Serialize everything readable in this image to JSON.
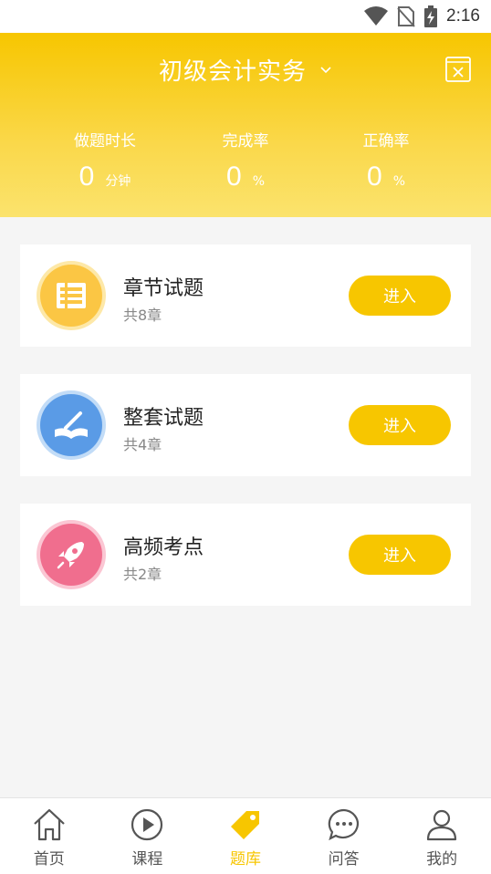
{
  "status_bar": {
    "time": "2:16"
  },
  "header": {
    "title": "初级会计实务",
    "stats": [
      {
        "label": "做题时长",
        "value": "0",
        "unit": "分钟"
      },
      {
        "label": "完成率",
        "value": "0",
        "unit": "%"
      },
      {
        "label": "正确率",
        "value": "0",
        "unit": "%"
      }
    ]
  },
  "cards": [
    {
      "title": "章节试题",
      "subtitle": "共8章",
      "button": "进入",
      "icon": "chapter-icon",
      "color": "#fbc644"
    },
    {
      "title": "整套试题",
      "subtitle": "共4章",
      "button": "进入",
      "icon": "book-pen-icon",
      "color": "#5a9be6"
    },
    {
      "title": "高频考点",
      "subtitle": "共2章",
      "button": "进入",
      "icon": "rocket-icon",
      "color": "#f06e8e"
    }
  ],
  "nav": [
    {
      "label": "首页",
      "icon": "home-icon"
    },
    {
      "label": "课程",
      "icon": "play-icon"
    },
    {
      "label": "题库",
      "icon": "tag-icon",
      "active": true
    },
    {
      "label": "问答",
      "icon": "chat-icon"
    },
    {
      "label": "我的",
      "icon": "user-icon"
    }
  ],
  "colors": {
    "accent": "#f7c600"
  }
}
